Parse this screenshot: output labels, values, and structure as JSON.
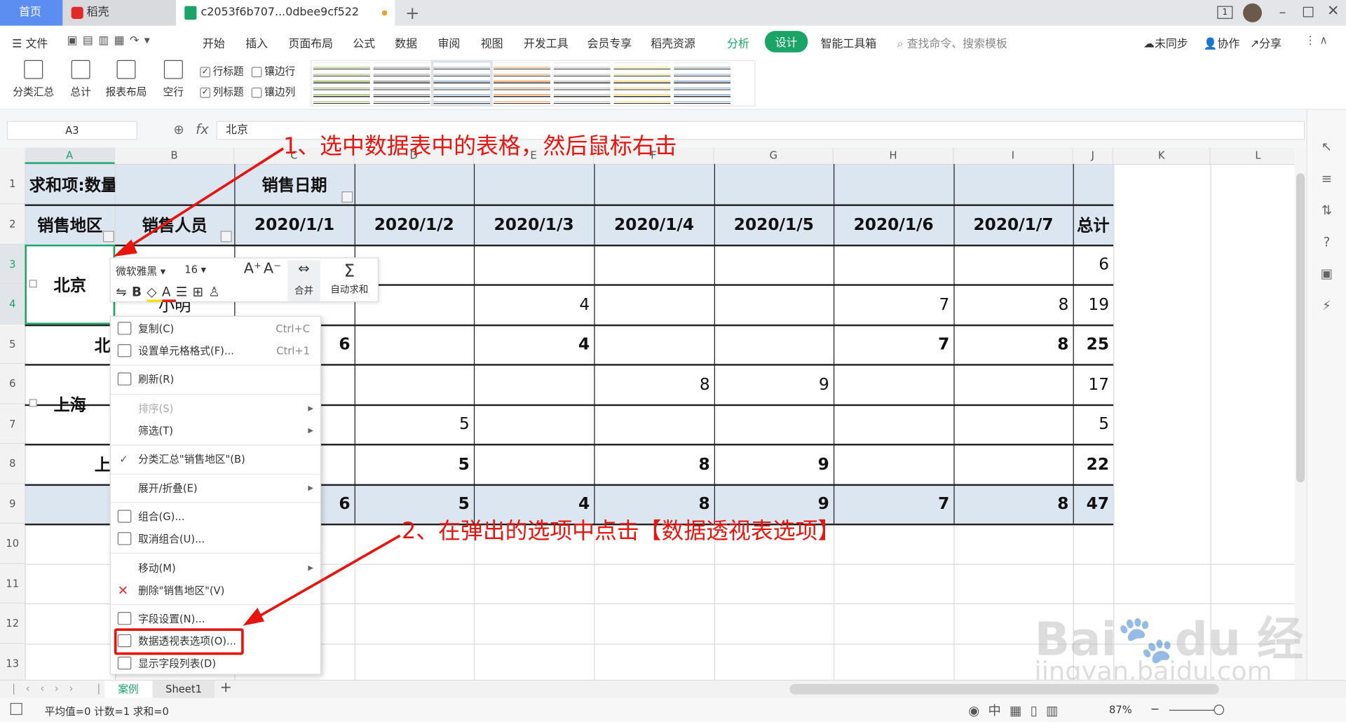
{
  "titlebar": {
    "tabs": [
      {
        "label": "首页"
      },
      {
        "label": "稻壳"
      },
      {
        "label": "c2053f6b707...0dbee9cf522"
      }
    ],
    "new_tab": "+",
    "page_count": "1"
  },
  "menubar": {
    "file": "文件",
    "items": [
      "开始",
      "插入",
      "页面布局",
      "公式",
      "数据",
      "审阅",
      "视图",
      "开发工具",
      "会员专享",
      "稻壳资源"
    ],
    "analyze": "分析",
    "design": "设计",
    "smart_tools": "智能工具箱",
    "search_placeholder": "查找命令、搜索模板",
    "unsynced": "未同步",
    "collab": "协作",
    "share": "分享",
    "accent": "#1ba467"
  },
  "ribbon": {
    "buttons": [
      "分类汇总",
      "总计",
      "报表布局",
      "空行"
    ],
    "checks": [
      {
        "label": "行标题",
        "checked": true
      },
      {
        "label": "镶边行",
        "checked": false
      },
      {
        "label": "列标题",
        "checked": true
      },
      {
        "label": "镶边列",
        "checked": false
      }
    ],
    "style_colors": [
      "#9bbb59",
      "#999999",
      "#95b3d7",
      "#f79646",
      "#bfbfbf",
      "#ffd966",
      "#8eaadb"
    ]
  },
  "formula_bar": {
    "name_box": "A3",
    "fx": "fx",
    "value": "北京"
  },
  "columns": [
    "A",
    "B",
    "C",
    "D",
    "E",
    "F",
    "G",
    "H",
    "I",
    "J",
    "K",
    "L"
  ],
  "rows": [
    "1",
    "2",
    "3",
    "4",
    "5",
    "6",
    "7",
    "8",
    "9",
    "10",
    "11",
    "12",
    "13"
  ],
  "pivot": {
    "r1": {
      "a": "求和项:数量",
      "c": "销售日期"
    },
    "r2": [
      "销售地区",
      "销售人员",
      "2020/1/1",
      "2020/1/2",
      "2020/1/3",
      "2020/1/4",
      "2020/1/5",
      "2020/1/6",
      "2020/1/7",
      "总计"
    ],
    "beijing": "北京",
    "b4": "小明",
    "shanghai": "上海",
    "bj_total": "北京 汇总",
    "sh_total": "上海 汇总",
    "cells": [
      {
        "r": 3,
        "c": 2,
        "v": "6"
      },
      {
        "r": 3,
        "c": 9,
        "v": "6"
      },
      {
        "r": 4,
        "c": 4,
        "v": "4"
      },
      {
        "r": 4,
        "c": 7,
        "v": "7"
      },
      {
        "r": 4,
        "c": 8,
        "v": "8"
      },
      {
        "r": 4,
        "c": 9,
        "v": "19"
      },
      {
        "r": 5,
        "c": 2,
        "v": "6",
        "b": 1
      },
      {
        "r": 5,
        "c": 4,
        "v": "4",
        "b": 1
      },
      {
        "r": 5,
        "c": 7,
        "v": "7",
        "b": 1
      },
      {
        "r": 5,
        "c": 8,
        "v": "8",
        "b": 1
      },
      {
        "r": 5,
        "c": 9,
        "v": "25",
        "b": 1
      },
      {
        "r": 6,
        "c": 5,
        "v": "8"
      },
      {
        "r": 6,
        "c": 6,
        "v": "9"
      },
      {
        "r": 6,
        "c": 9,
        "v": "17"
      },
      {
        "r": 7,
        "c": 3,
        "v": "5"
      },
      {
        "r": 7,
        "c": 9,
        "v": "5"
      },
      {
        "r": 8,
        "c": 3,
        "v": "5",
        "b": 1
      },
      {
        "r": 8,
        "c": 5,
        "v": "8",
        "b": 1
      },
      {
        "r": 8,
        "c": 6,
        "v": "9",
        "b": 1
      },
      {
        "r": 8,
        "c": 9,
        "v": "22",
        "b": 1
      },
      {
        "r": 9,
        "c": 2,
        "v": "6",
        "b": 1
      },
      {
        "r": 9,
        "c": 3,
        "v": "5",
        "b": 1
      },
      {
        "r": 9,
        "c": 4,
        "v": "4",
        "b": 1
      },
      {
        "r": 9,
        "c": 5,
        "v": "8",
        "b": 1
      },
      {
        "r": 9,
        "c": 6,
        "v": "9",
        "b": 1
      },
      {
        "r": 9,
        "c": 7,
        "v": "7",
        "b": 1
      },
      {
        "r": 9,
        "c": 8,
        "v": "8",
        "b": 1
      },
      {
        "r": 9,
        "c": 9,
        "v": "47",
        "b": 1
      }
    ],
    "header_bg": "#dce6f1"
  },
  "mini_toolbar": {
    "font": "微软雅黑",
    "size": "16",
    "merge": "合并",
    "autosum": "自动求和"
  },
  "context_menu": {
    "copy": "复制(C)",
    "copy_sc": "Ctrl+C",
    "format": "设置单元格格式(F)...",
    "format_sc": "Ctrl+1",
    "refresh": "刷新(R)",
    "sort": "排序(S)",
    "filter": "筛选(T)",
    "subtotal": "分类汇总\"销售地区\"(B)",
    "expand": "展开/折叠(E)",
    "group": "组合(G)...",
    "ungroup": "取消组合(U)...",
    "move": "移动(M)",
    "delete": "删除\"销售地区\"(V)",
    "field_settings": "字段设置(N)...",
    "pivot_options": "数据透视表选项(O)...",
    "show_field_list": "显示字段列表(D)"
  },
  "annotations": {
    "step1": "1、选中数据表中的表格，然后鼠标右击",
    "step2": "2、在弹出的选项中点击【数据透视表选项】",
    "color": "#e8140e"
  },
  "sheet_tabs": {
    "tabs": [
      "案例",
      "Sheet1"
    ],
    "active": "案例",
    "add": "+"
  },
  "status": {
    "summary": "平均值=0  计数=1  求和=0",
    "zoom": "87%"
  },
  "watermark": {
    "text": "Baidu经验",
    "url": "jingyan.baidu.com"
  }
}
